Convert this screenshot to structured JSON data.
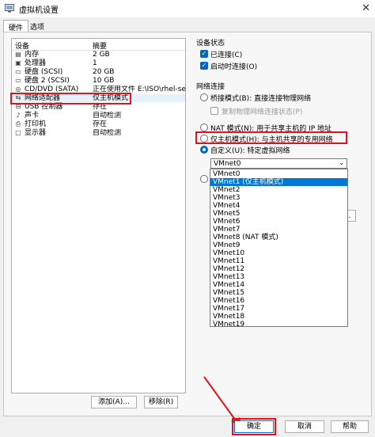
{
  "window": {
    "title": "虚拟机设置",
    "close_glyph": "✕"
  },
  "tabs": [
    {
      "label": "硬件"
    },
    {
      "label": "选项"
    }
  ],
  "device_list": {
    "headers": {
      "device": "设备",
      "summary": "摘要"
    },
    "rows": [
      {
        "name": "内存",
        "summary": "2 GB",
        "icon": "memory-icon",
        "glyph": "▤"
      },
      {
        "name": "处理器",
        "summary": "1",
        "icon": "processor-icon",
        "glyph": "▣"
      },
      {
        "name": "硬盘 (SCSI)",
        "summary": "20 GB",
        "icon": "hard-disk-icon",
        "glyph": "▭"
      },
      {
        "name": "硬盘 2 (SCSI)",
        "summary": "10 GB",
        "icon": "hard-disk-icon",
        "glyph": "▭"
      },
      {
        "name": "CD/DVD (SATA)",
        "summary": "正在使用文件 E:\\ISO\\rhel-se...",
        "icon": "cd-dvd-icon",
        "glyph": "◎"
      },
      {
        "name": "网络适配器",
        "summary": "仅主机模式",
        "icon": "network-adapter-icon",
        "glyph": "⇆"
      },
      {
        "name": "USB 控制器",
        "summary": "存在",
        "icon": "usb-icon",
        "glyph": "⊟"
      },
      {
        "name": "声卡",
        "summary": "自动检测",
        "icon": "sound-card-icon",
        "glyph": "♪"
      },
      {
        "name": "打印机",
        "summary": "存在",
        "icon": "printer-icon",
        "glyph": "⎙"
      },
      {
        "name": "显示器",
        "summary": "自动检测",
        "icon": "monitor-icon",
        "glyph": "▢"
      }
    ],
    "add_button": "添加(A)...",
    "remove_button": "移除(R)"
  },
  "device_status": {
    "title": "设备状态",
    "connected": "已连接(C)",
    "connect_at_power_on": "启动时连接(O)"
  },
  "network_connection": {
    "title": "网络连接",
    "bridged": "桥接模式(B): 直接连接物理网络",
    "replicate": "复制物理网络连接状态(P)",
    "nat": "NAT 模式(N): 用于共享主机的 IP 地址",
    "host_only": "仅主机模式(H): 与主机共享的专用网络",
    "custom": "自定义(U): 特定虚拟网络",
    "selected_network": "VMnet0",
    "chevron": "⌄"
  },
  "vmnet_options": [
    "VMnet0",
    "VMnet1 (仅主机模式)",
    "VMnet2",
    "VMnet3",
    "VMnet4",
    "VMnet5",
    "VMnet6",
    "VMnet7",
    "VMnet8 (NAT 模式)",
    "VMnet9",
    "VMnet10",
    "VMnet11",
    "VMnet12",
    "VMnet13",
    "VMnet14",
    "VMnet15",
    "VMnet16",
    "VMnet17",
    "VMnet18",
    "VMnet19"
  ],
  "highlighted_option": "VMnet1 (仅主机模式)",
  "footer": {
    "ok": "确定",
    "cancel": "取消",
    "help": "帮助"
  },
  "colors": {
    "highlight_box": "#e0141e",
    "accent": "#0078d7"
  }
}
